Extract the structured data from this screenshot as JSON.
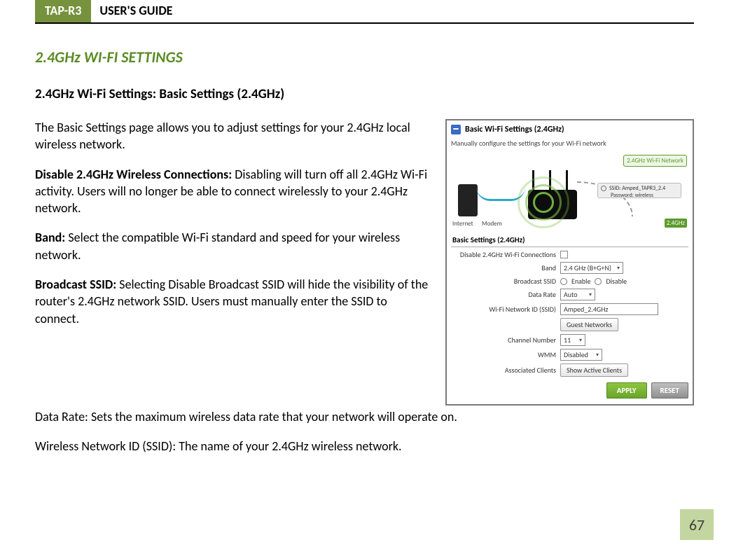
{
  "header": {
    "band": "TAP-R3",
    "title": "USER'S GUIDE"
  },
  "section_title": "2.4GHz WI-FI SETTINGS",
  "sub_title": "2.4GHz Wi-Fi Settings: Basic Settings (2.4GHz)",
  "paras": {
    "intro": "The Basic Settings page allows you to adjust settings for your 2.4GHz local wireless network.",
    "disable_t": "Disable 2.4GHz Wireless Connections: ",
    "disable_b": "Disabling will turn off all 2.4GHz Wi-Fi activity. Users will no longer be able to connect wirelessly to your 2.4GHz network.",
    "band_t": "Band: ",
    "band_b": "Select the compatible Wi-Fi standard and speed for your wireless network.",
    "bcast_t": "Broadcast SSID: ",
    "bcast_b": "Selecting Disable Broadcast SSID will hide the visibility of the router's 2.4GHz network SSID. Users must manually enter the SSID to connect.",
    "rate_t": "Data Rate: ",
    "rate_b": "Sets the maximum wireless data rate that your network will operate on.",
    "ssid_t": "Wireless Network ID (SSID): ",
    "ssid_b": "The name of your 2.4GHz wireless network."
  },
  "figure": {
    "top_title": "Basic Wi-Fi Settings (2.4GHz)",
    "subtitle": "Manually configure the settings for your Wi-Fi network",
    "net_label": "2.4GHz Wi-Fi Network",
    "internet_lbl": "Internet",
    "modem_lbl": "Modem",
    "ssid_chip_l1": "SSID: Amped_TAPR3_2.4",
    "ssid_chip_l2": "Password: wireless",
    "tag24": "2.4GHz",
    "panel_title": "Basic Settings (2.4GHz)",
    "rows": {
      "disable_lbl": "Disable 2.4GHz Wi-Fi Connections",
      "band_lbl": "Band",
      "band_val": "2.4 GHz (B+G+N)",
      "bcast_lbl": "Broadcast SSID",
      "bcast_en": "Enable",
      "bcast_dis": "Disable",
      "rate_lbl": "Data Rate",
      "rate_val": "Auto",
      "ssid_lbl": "Wi-Fi Network ID (SSID)",
      "ssid_val": "Amped_2.4GHz",
      "guest_btn": "Guest Networks",
      "chan_lbl": "Channel Number",
      "chan_val": "11",
      "wmm_lbl": "WMM",
      "wmm_val": "Disabled",
      "assoc_lbl": "Associated Clients",
      "assoc_btn": "Show Active Clients"
    },
    "apply": "APPLY",
    "reset": "RESET"
  },
  "page_number": "67"
}
